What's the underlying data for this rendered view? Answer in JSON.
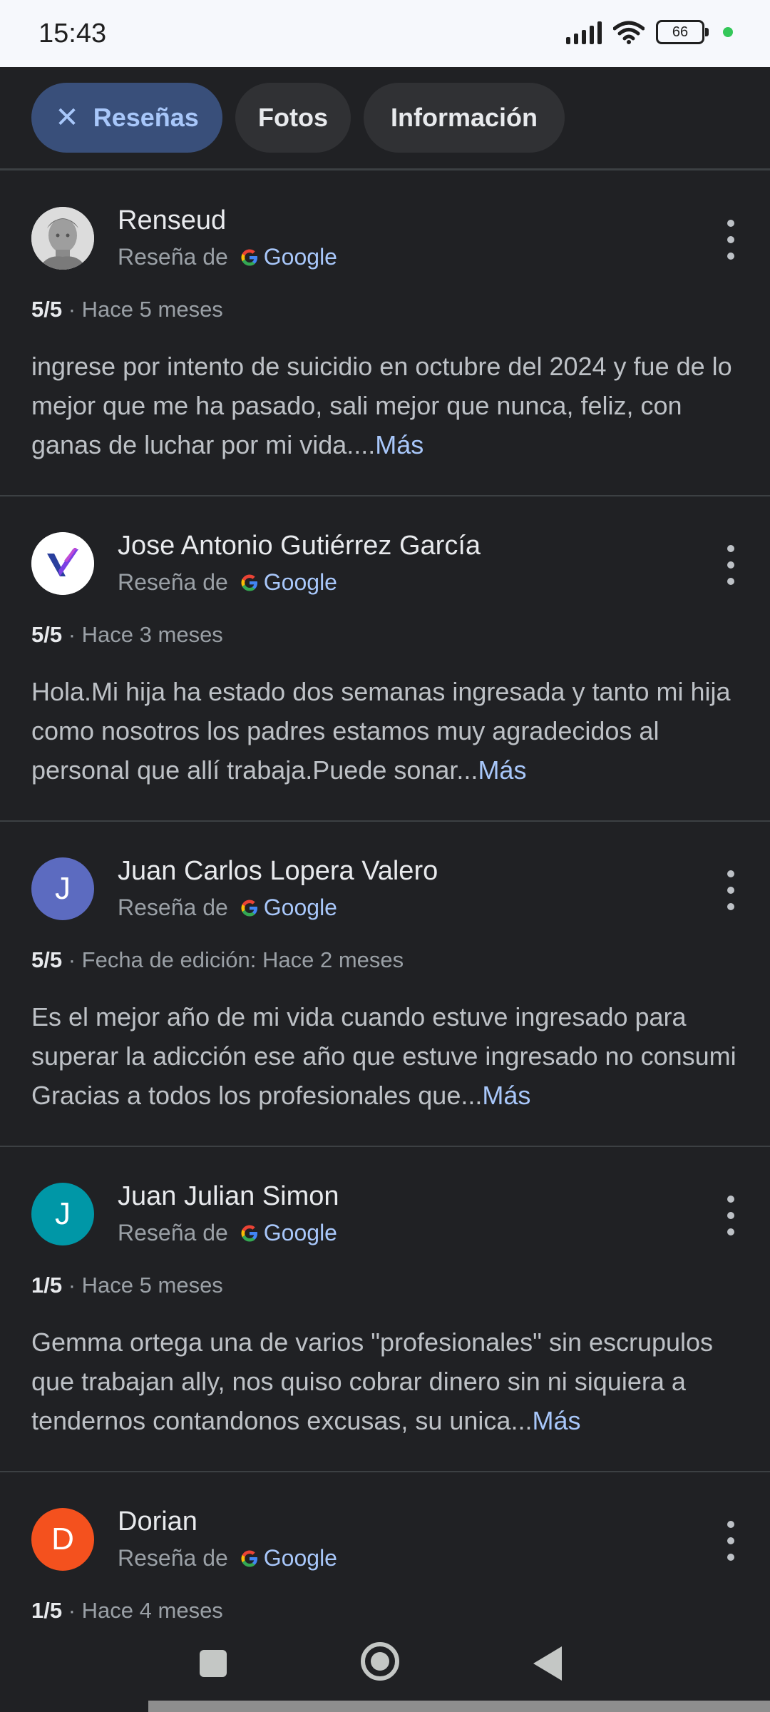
{
  "status_bar": {
    "time": "15:43",
    "battery": "66",
    "icons": [
      "signal-icon",
      "wifi-icon",
      "battery-icon"
    ]
  },
  "tabs": {
    "reviews": {
      "label": "Reseñas",
      "close_icon": "close-icon",
      "active": true
    },
    "photos": {
      "label": "Fotos"
    },
    "info": {
      "label": "Información"
    }
  },
  "source_prefix": "Reseña de",
  "source_name": "Google",
  "more_label": "Más",
  "reviews": [
    {
      "author": "Renseud",
      "avatar": {
        "type": "photo",
        "icon": "statue-avatar-icon"
      },
      "score": "5/5",
      "time": "· Hace 5 meses",
      "text": "ingrese por intento de suicidio en octubre del 2024 y fue de lo mejor que me ha pasado, sali mejor que nunca, feliz, con ganas de luchar por mi vida...."
    },
    {
      "author": "Jose Antonio Gutiérrez García",
      "avatar": {
        "type": "logo",
        "icon": "v-logo-avatar-icon"
      },
      "score": "5/5",
      "time": "· Hace 3 meses",
      "text": "Hola.Mi hija ha estado dos semanas ingresada y tanto mi hija como nosotros los padres estamos muy agradecidos al personal que allí trabaja.Puede sonar..."
    },
    {
      "author": "Juan Carlos Lopera Valero",
      "avatar": {
        "type": "letter",
        "letter": "J",
        "color": "#5c6bc0"
      },
      "score": "5/5",
      "time": "· Fecha de edición: Hace 2 meses",
      "text": "Es el mejor año de mi vida cuando estuve ingresado para superar la adicción ese año que estuve ingresado no consumi Gracias a todos los profesionales que..."
    },
    {
      "author": "Juan Julian Simon",
      "avatar": {
        "type": "letter",
        "letter": "J",
        "color": "#0097a7"
      },
      "score": "1/5",
      "time": "· Hace 5 meses",
      "text": "Gemma ortega una de varios \"profesionales\" sin escrupulos que trabajan ally, nos quiso cobrar dinero sin ni siquiera a tendernos contandonos excusas, su unica..."
    },
    {
      "author": "Dorian",
      "avatar": {
        "type": "letter",
        "letter": "D",
        "color": "#f4511e"
      },
      "score": "1/5",
      "time": "· Hace 4 meses",
      "text": ""
    }
  ],
  "nav": {
    "icons": [
      "recents-icon",
      "home-icon",
      "back-icon"
    ]
  }
}
